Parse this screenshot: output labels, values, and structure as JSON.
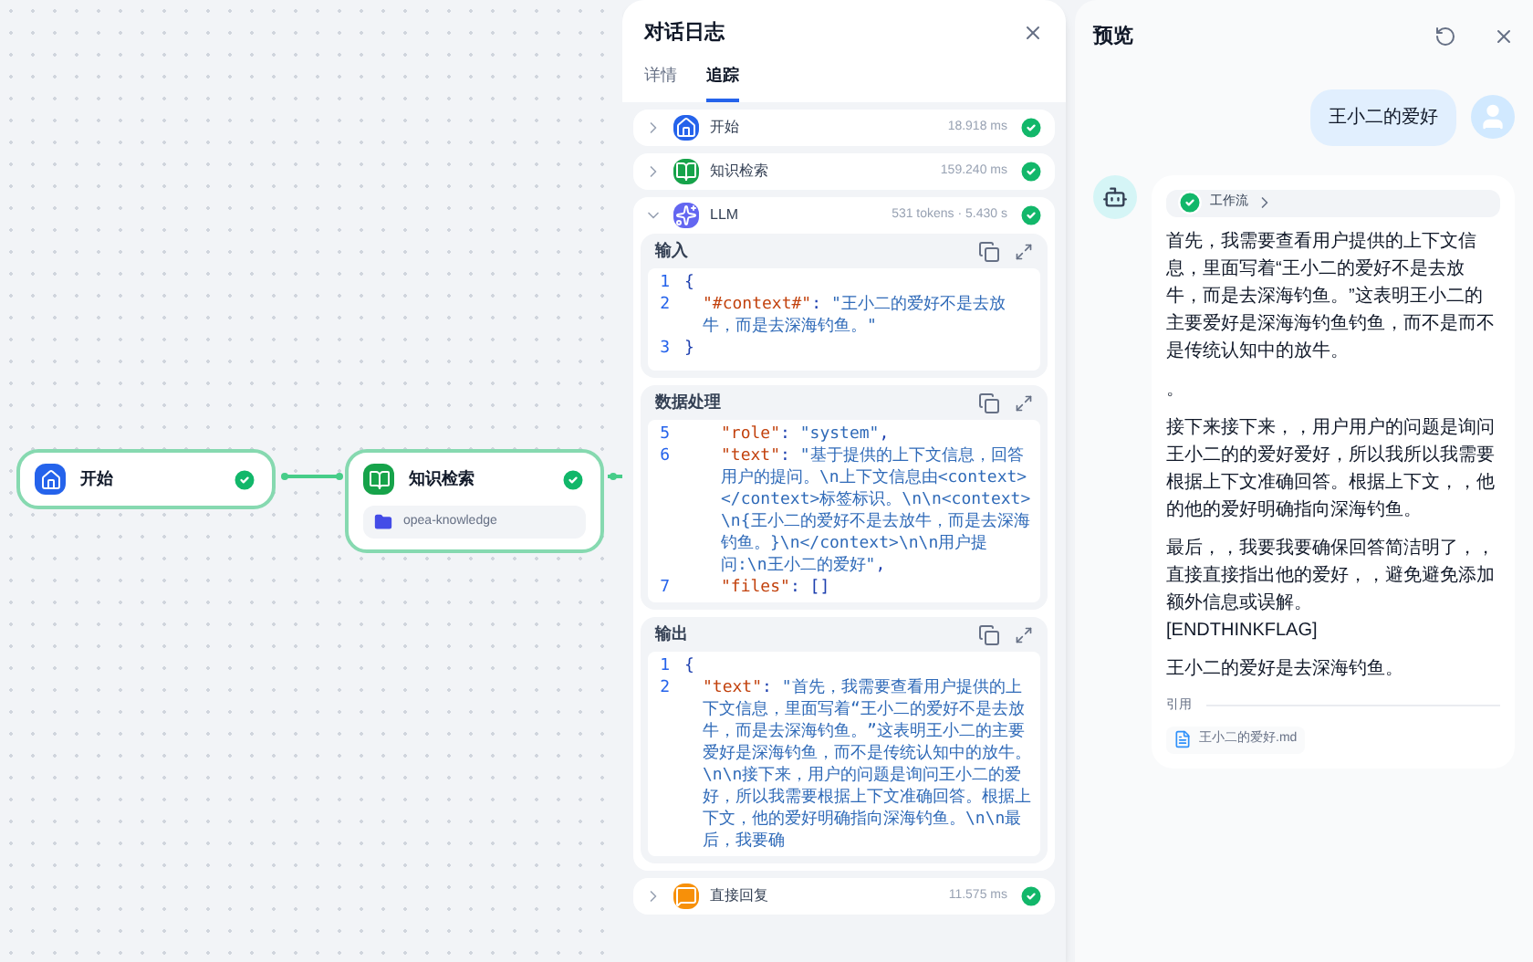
{
  "canvas": {
    "nodes": [
      {
        "kind": "start",
        "title": "开始",
        "success": true
      },
      {
        "kind": "knowledge",
        "title": "知识检索",
        "success": true,
        "dataset": "opea-knowledge"
      }
    ]
  },
  "log": {
    "title": "对话日志",
    "tabs": [
      {
        "label": "详情",
        "selected": false
      },
      {
        "label": "追踪",
        "selected": true
      }
    ],
    "steps": [
      {
        "kind": "start",
        "title": "开始",
        "meta": "18.918 ms",
        "success": true,
        "expanded": false
      },
      {
        "kind": "knowledge",
        "title": "知识检索",
        "meta": "159.240 ms",
        "success": true,
        "expanded": false
      },
      {
        "kind": "llm",
        "title": "LLM",
        "meta": "531 tokens · 5.430 s",
        "success": true,
        "expanded": true,
        "sections": [
          {
            "title": "输入",
            "lines": [
              {
                "no": "1",
                "kind": "bracket",
                "tokens": [
                  {
                    "kind": "punct",
                    "text": "{"
                  }
                ]
              },
              {
                "no": "2",
                "kind": "member",
                "tokens": [
                  {
                    "kind": "key",
                    "text": "\"#context#\""
                  },
                  {
                    "kind": "punct",
                    "text": ": "
                  },
                  {
                    "kind": "string",
                    "text": "\"王小二的爱好不是去放牛，而是去深海钓鱼。\""
                  }
                ]
              },
              {
                "no": "3",
                "kind": "bracket",
                "tokens": [
                  {
                    "kind": "punct",
                    "text": "}"
                  }
                ]
              }
            ]
          },
          {
            "title": "数据处理",
            "lines": [
              {
                "no": "5",
                "kind": "nested_member",
                "tokens": [
                  {
                    "kind": "key",
                    "text": "\"role\""
                  },
                  {
                    "kind": "punct",
                    "text": ": "
                  },
                  {
                    "kind": "string",
                    "text": "\"system\""
                  },
                  {
                    "kind": "punct",
                    "text": ","
                  }
                ]
              },
              {
                "no": "6",
                "kind": "nested_member",
                "tokens": [
                  {
                    "kind": "key",
                    "text": "\"text\""
                  },
                  {
                    "kind": "punct",
                    "text": ": "
                  },
                  {
                    "kind": "string",
                    "text": "\"基于提供的上下文信息，回答用户的提问。\\n上下文信息由<context></context>标签标识。\\n\\n<context>\\n{王小二的爱好不是去放牛，而是去深海钓鱼。}\\n</context>\\n\\n用户提问:\\n王小二的爱好\""
                  },
                  {
                    "kind": "punct",
                    "text": ","
                  }
                ]
              },
              {
                "no": "7",
                "kind": "nested_member",
                "tokens": [
                  {
                    "kind": "key",
                    "text": "\"files\""
                  },
                  {
                    "kind": "punct",
                    "text": ": []"
                  }
                ]
              }
            ]
          },
          {
            "title": "输出",
            "lines": [
              {
                "no": "1",
                "kind": "bracket",
                "tokens": [
                  {
                    "kind": "punct",
                    "text": "{"
                  }
                ]
              },
              {
                "no": "2",
                "kind": "member",
                "tokens": [
                  {
                    "kind": "key",
                    "text": "\"text\""
                  },
                  {
                    "kind": "punct",
                    "text": ": "
                  },
                  {
                    "kind": "string",
                    "text": "\"首先，我需要查看用户提供的上下文信息，里面写着“王小二的爱好不是去放牛，而是去深海钓鱼。”这表明王小二的主要爱好是深海钓鱼，而不是传统认知中的放牛。\\n\\n接下来，用户的问题是询问王小二的爱好，所以我需要根据上下文准确回答。根据上下文，他的爱好明确指向深海钓鱼。\\n\\n最后，我要确"
                  }
                ]
              }
            ]
          }
        ]
      },
      {
        "kind": "reply",
        "title": "直接回复",
        "meta": "11.575 ms",
        "success": true,
        "expanded": false
      }
    ]
  },
  "preview": {
    "title": "预览",
    "user_message": "王小二的爱好",
    "bot": {
      "workflow": {
        "label": "工作流",
        "success": true
      },
      "paragraphs": [
        {
          "kind": "text",
          "text": "首先，我需要查看用户提供的上下文信息，里面写着“王小二的爱好不是去放牛，而是去深海钓鱼。”这表明王小二的主要爱好是深海海钓鱼钓鱼，而不是而不是传统认知中的放牛。"
        },
        {
          "kind": "text",
          "text": "。"
        },
        {
          "kind": "text",
          "text": "接下来接下来，，用户用户的问题是询问王小二的的爱好爱好，所以我所以我需要根据上下文准确回答。根据上下文，，他的他的爱好明确指向深海钓鱼。"
        },
        {
          "kind": "text",
          "text": "最后，，我要我要确保回答简洁明了，，直接直接指出他的爱好，，避免避免添加额外信息或误解。"
        },
        {
          "kind": "flag",
          "text": "[ENDTHINKFLAG]"
        },
        {
          "kind": "text",
          "text": "王小二的爱好是去深海钓鱼。"
        }
      ],
      "citation_label": "引用",
      "citations": [
        {
          "name": "王小二的爱好.md"
        }
      ]
    }
  }
}
